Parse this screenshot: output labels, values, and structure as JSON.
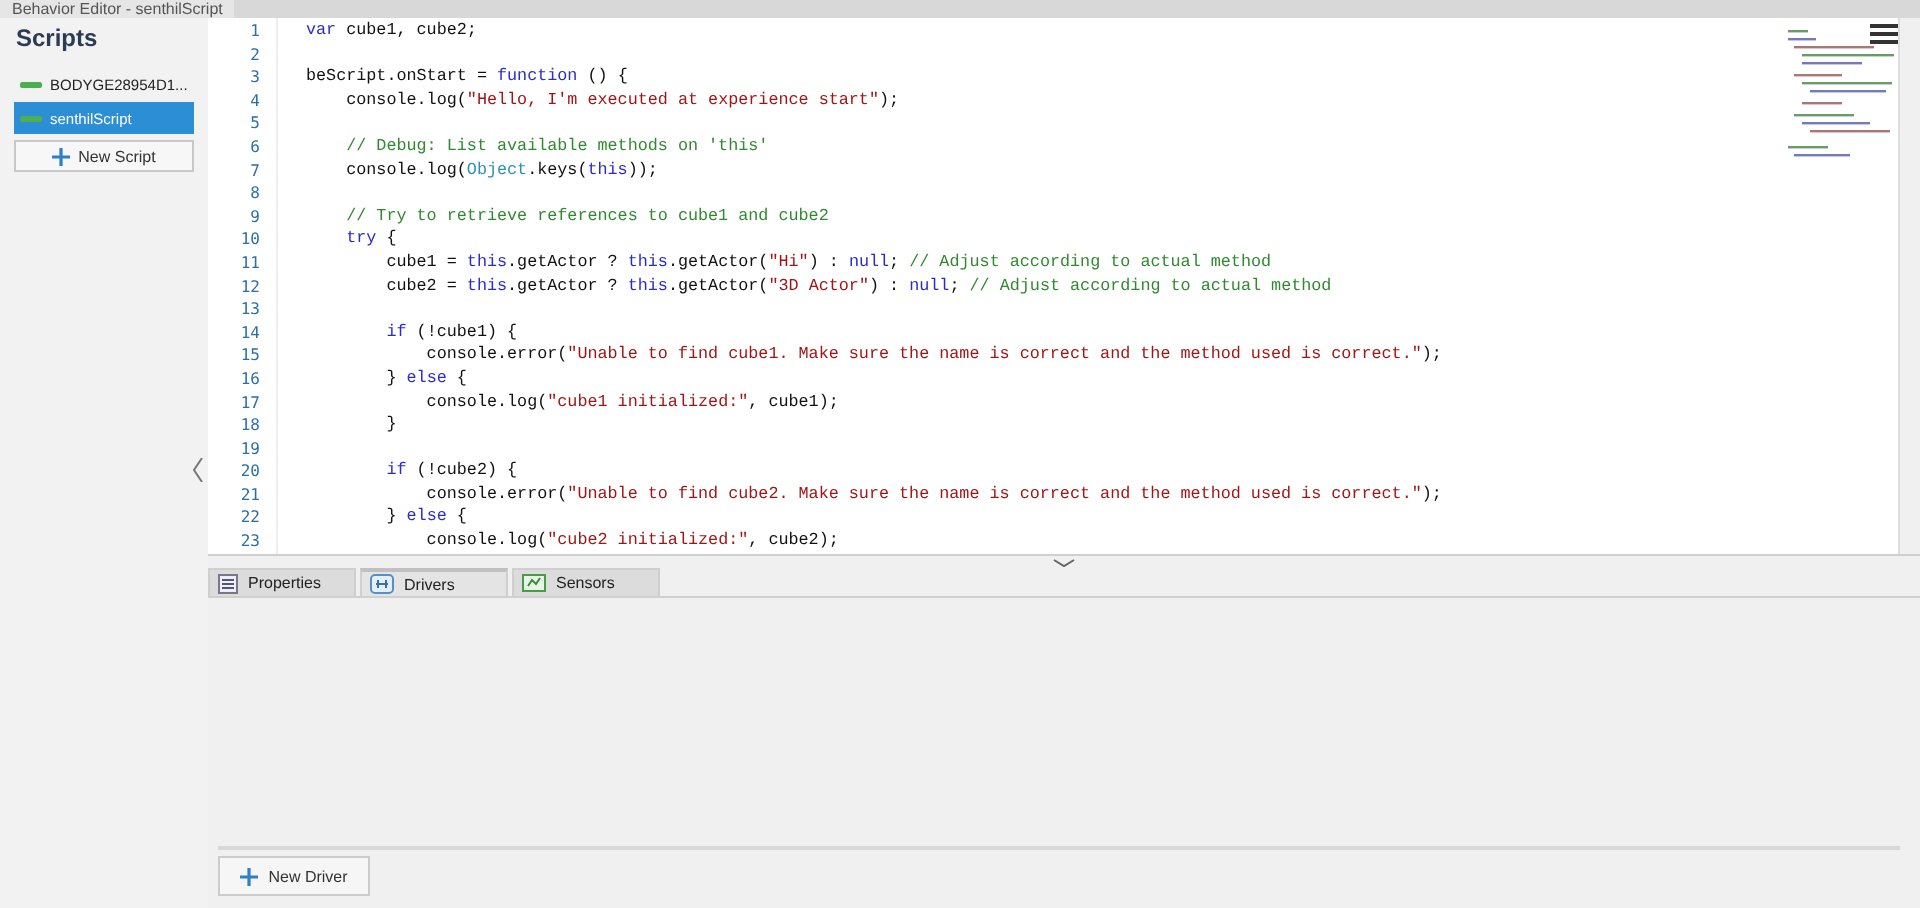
{
  "window": {
    "title": "Behavior Editor - senthilScript"
  },
  "sidebar": {
    "title": "Scripts",
    "items": [
      {
        "label": "BODYGE28954D1...",
        "selected": false,
        "color": "#4caf50"
      },
      {
        "label": "senthilScript",
        "selected": true,
        "color": "#4caf50"
      }
    ],
    "new_button": "New Script"
  },
  "editor": {
    "lines": [
      {
        "number": "1",
        "tokens": [
          {
            "kind": "keyword",
            "text": "var"
          },
          {
            "kind": "plain",
            "text": " cube1, cube2;"
          }
        ]
      },
      {
        "number": "2"
      },
      {
        "number": "3",
        "tokens": [
          {
            "kind": "plain",
            "text": "beScript.onStart = "
          },
          {
            "kind": "keyword",
            "text": "function"
          },
          {
            "kind": "plain",
            "text": " () {"
          }
        ]
      },
      {
        "number": "4",
        "tokens": [
          {
            "kind": "plain",
            "text": "    console.log("
          },
          {
            "kind": "string",
            "text": "\"Hello, I'm executed at experience start\""
          },
          {
            "kind": "plain",
            "text": ");"
          }
        ]
      },
      {
        "number": "5"
      },
      {
        "number": "6",
        "tokens": [
          {
            "kind": "comment",
            "text": "    // Debug: List available methods on 'this'"
          }
        ]
      },
      {
        "number": "7",
        "tokens": [
          {
            "kind": "plain",
            "text": "    console.log("
          },
          {
            "kind": "type",
            "text": "Object"
          },
          {
            "kind": "plain",
            "text": ".keys("
          },
          {
            "kind": "keyword",
            "text": "this"
          },
          {
            "kind": "plain",
            "text": "));"
          }
        ]
      },
      {
        "number": "8"
      },
      {
        "number": "9",
        "tokens": [
          {
            "kind": "comment",
            "text": "    // Try to retrieve references to cube1 and cube2"
          }
        ]
      },
      {
        "number": "10",
        "tokens": [
          {
            "kind": "keyword",
            "text": "    try"
          },
          {
            "kind": "plain",
            "text": " {"
          }
        ]
      },
      {
        "number": "11",
        "tokens": [
          {
            "kind": "plain",
            "text": "        cube1 = "
          },
          {
            "kind": "keyword",
            "text": "this"
          },
          {
            "kind": "plain",
            "text": ".getActor ? "
          },
          {
            "kind": "keyword",
            "text": "this"
          },
          {
            "kind": "plain",
            "text": ".getActor("
          },
          {
            "kind": "string",
            "text": "\"Hi\""
          },
          {
            "kind": "plain",
            "text": ") : "
          },
          {
            "kind": "keyword",
            "text": "null"
          },
          {
            "kind": "plain",
            "text": "; "
          },
          {
            "kind": "comment",
            "text": "// Adjust according to actual method"
          }
        ]
      },
      {
        "number": "12",
        "tokens": [
          {
            "kind": "plain",
            "text": "        cube2 = "
          },
          {
            "kind": "keyword",
            "text": "this"
          },
          {
            "kind": "plain",
            "text": ".getActor ? "
          },
          {
            "kind": "keyword",
            "text": "this"
          },
          {
            "kind": "plain",
            "text": ".getActor("
          },
          {
            "kind": "string",
            "text": "\"3D Actor\""
          },
          {
            "kind": "plain",
            "text": ") : "
          },
          {
            "kind": "keyword",
            "text": "null"
          },
          {
            "kind": "plain",
            "text": "; "
          },
          {
            "kind": "comment",
            "text": "// Adjust according to actual method"
          }
        ]
      },
      {
        "number": "13"
      },
      {
        "number": "14",
        "tokens": [
          {
            "kind": "keyword",
            "text": "        if"
          },
          {
            "kind": "plain",
            "text": " (!cube1) {"
          }
        ]
      },
      {
        "number": "15",
        "tokens": [
          {
            "kind": "plain",
            "text": "            console.error("
          },
          {
            "kind": "string",
            "text": "\"Unable to find cube1. Make sure the name is correct and the method used is correct.\""
          },
          {
            "kind": "plain",
            "text": ");"
          }
        ]
      },
      {
        "number": "16",
        "tokens": [
          {
            "kind": "plain",
            "text": "        } "
          },
          {
            "kind": "keyword",
            "text": "else"
          },
          {
            "kind": "plain",
            "text": " {"
          }
        ]
      },
      {
        "number": "17",
        "tokens": [
          {
            "kind": "plain",
            "text": "            console.log("
          },
          {
            "kind": "string",
            "text": "\"cube1 initialized:\""
          },
          {
            "kind": "plain",
            "text": ", cube1);"
          }
        ]
      },
      {
        "number": "18",
        "tokens": [
          {
            "kind": "plain",
            "text": "        }"
          }
        ]
      },
      {
        "number": "19"
      },
      {
        "number": "20",
        "tokens": [
          {
            "kind": "keyword",
            "text": "        if"
          },
          {
            "kind": "plain",
            "text": " (!cube2) {"
          }
        ]
      },
      {
        "number": "21",
        "tokens": [
          {
            "kind": "plain",
            "text": "            console.error("
          },
          {
            "kind": "string",
            "text": "\"Unable to find cube2. Make sure the name is correct and the method used is correct.\""
          },
          {
            "kind": "plain",
            "text": ");"
          }
        ]
      },
      {
        "number": "22",
        "tokens": [
          {
            "kind": "plain",
            "text": "        } "
          },
          {
            "kind": "keyword",
            "text": "else"
          },
          {
            "kind": "plain",
            "text": " {"
          }
        ]
      },
      {
        "number": "23",
        "tokens": [
          {
            "kind": "plain",
            "text": "            console.log("
          },
          {
            "kind": "string",
            "text": "\"cube2 initialized:\""
          },
          {
            "kind": "plain",
            "text": ", cube2);"
          }
        ]
      }
    ]
  },
  "tabs": [
    {
      "label": "Properties",
      "kind": "list",
      "selected": false
    },
    {
      "label": "Drivers",
      "kind": "drivers",
      "selected": true
    },
    {
      "label": "Sensors",
      "kind": "sensor",
      "selected": false
    }
  ],
  "panel": {
    "new_button": "New Driver"
  }
}
